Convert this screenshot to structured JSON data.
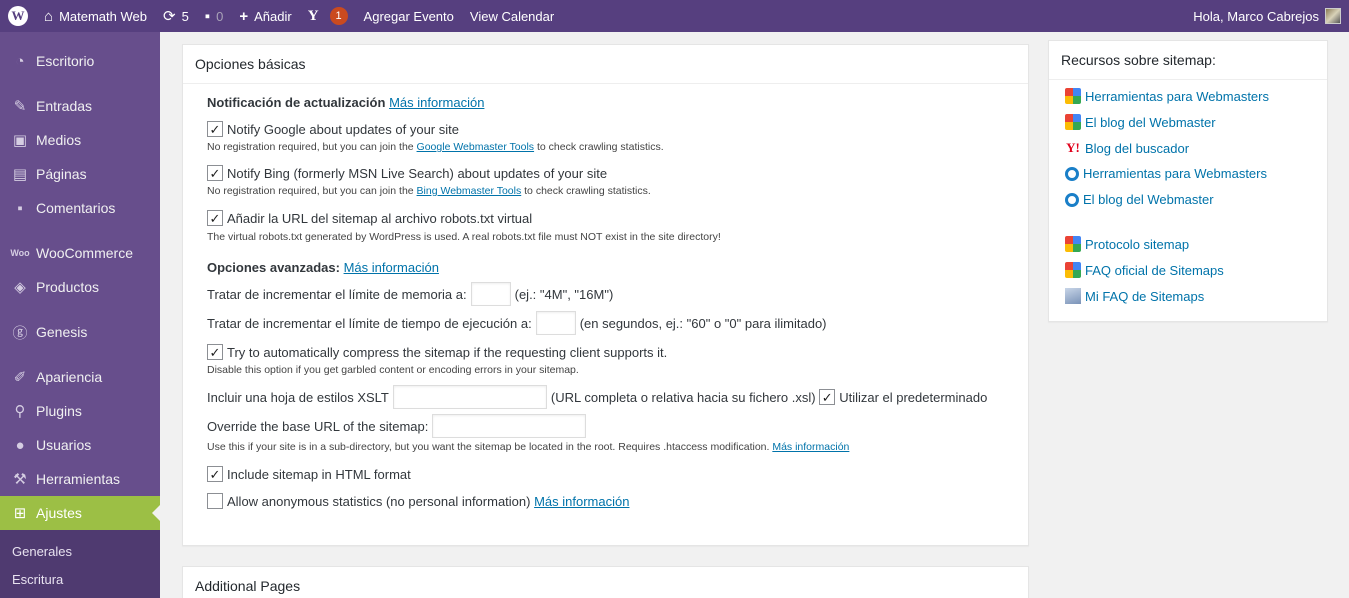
{
  "adminbar": {
    "site_name": "Matemath Web",
    "updates_count": "5",
    "comments_count": "0",
    "add_label": "Añadir",
    "yoast_count": "1",
    "add_event_label": "Agregar Evento",
    "view_calendar_label": "View Calendar",
    "greeting": "Hola, Marco Cabrejos"
  },
  "sidebar": {
    "items": [
      {
        "label": "Escritorio",
        "icon": "dashboard-icon"
      },
      {
        "label": "Entradas",
        "icon": "pin-icon"
      },
      {
        "label": "Medios",
        "icon": "media-icon"
      },
      {
        "label": "Páginas",
        "icon": "pages-icon"
      },
      {
        "label": "Comentarios",
        "icon": "comments-icon"
      },
      {
        "label": "WooCommerce",
        "icon": "woo-icon"
      },
      {
        "label": "Productos",
        "icon": "box-icon"
      },
      {
        "label": "Genesis",
        "icon": "genesis-icon"
      },
      {
        "label": "Apariencia",
        "icon": "brush-icon"
      },
      {
        "label": "Plugins",
        "icon": "plugin-icon"
      },
      {
        "label": "Usuarios",
        "icon": "user-icon"
      },
      {
        "label": "Herramientas",
        "icon": "wrench-icon"
      },
      {
        "label": "Ajustes",
        "icon": "settings-icon"
      }
    ],
    "submenu": [
      "Generales",
      "Escritura"
    ]
  },
  "basic": {
    "title": "Opciones básicas",
    "notify_heading": "Notificación de actualización",
    "more_info": "Más información",
    "notify_google": "Notify Google about updates of your site",
    "google_note_pre": "No registration required, but you can join the",
    "google_note_link": "Google Webmaster Tools",
    "google_note_post": "to check crawling statistics.",
    "notify_bing": "Notify Bing (formerly MSN Live Search) about updates of your site",
    "bing_note_pre": "No registration required, but you can join the",
    "bing_note_link": "Bing Webmaster Tools",
    "bing_note_post": "to check crawling statistics.",
    "robots_label": "Añadir la URL del sitemap al archivo robots.txt virtual",
    "robots_note": "The virtual robots.txt generated by WordPress is used. A real robots.txt file must NOT exist in the site directory!",
    "advanced_heading": "Opciones avanzadas:",
    "memory_label": "Tratar de incrementar el límite de memoria a:",
    "memory_hint": "(ej.: \"4M\", \"16M\")",
    "time_label": "Tratar de incrementar el límite de tiempo de ejecución a:",
    "time_hint": "(en segundos, ej.: \"60\" o \"0\" para ilimitado)",
    "compress_label": "Try to automatically compress the sitemap if the requesting client supports it.",
    "compress_note": "Disable this option if you get garbled content or encoding errors in your sitemap.",
    "xslt_label": "Incluir una hoja de estilos XSLT",
    "xslt_hint": "(URL completa o relativa hacia su fichero .xsl)",
    "xslt_default": "Utilizar el predeterminado",
    "baseurl_label": "Override the base URL of the sitemap:",
    "baseurl_note": "Use this if your site is in a sub-directory, but you want the sitemap be located in the root. Requires .htaccess modification.",
    "html_label": "Include sitemap in HTML format",
    "stats_label": "Allow anonymous statistics (no personal information)",
    "check_mark": "✓"
  },
  "additional": {
    "title": "Additional Pages"
  },
  "resources": {
    "title": "Recursos sobre sitemap:",
    "items": [
      {
        "label": "Herramientas para Webmasters",
        "icon": "google-icon"
      },
      {
        "label": "El blog del Webmaster",
        "icon": "google-icon"
      },
      {
        "label": "Blog del buscador",
        "icon": "yahoo-icon"
      },
      {
        "label": "Herramientas para Webmasters",
        "icon": "bing-icon"
      },
      {
        "label": "El blog del Webmaster",
        "icon": "bing-icon"
      },
      {
        "label": "Protocolo sitemap",
        "icon": "google-icon"
      },
      {
        "label": "FAQ oficial de Sitemaps",
        "icon": "google-icon"
      },
      {
        "label": "Mi FAQ de Sitemaps",
        "icon": "faq-icon"
      }
    ]
  }
}
